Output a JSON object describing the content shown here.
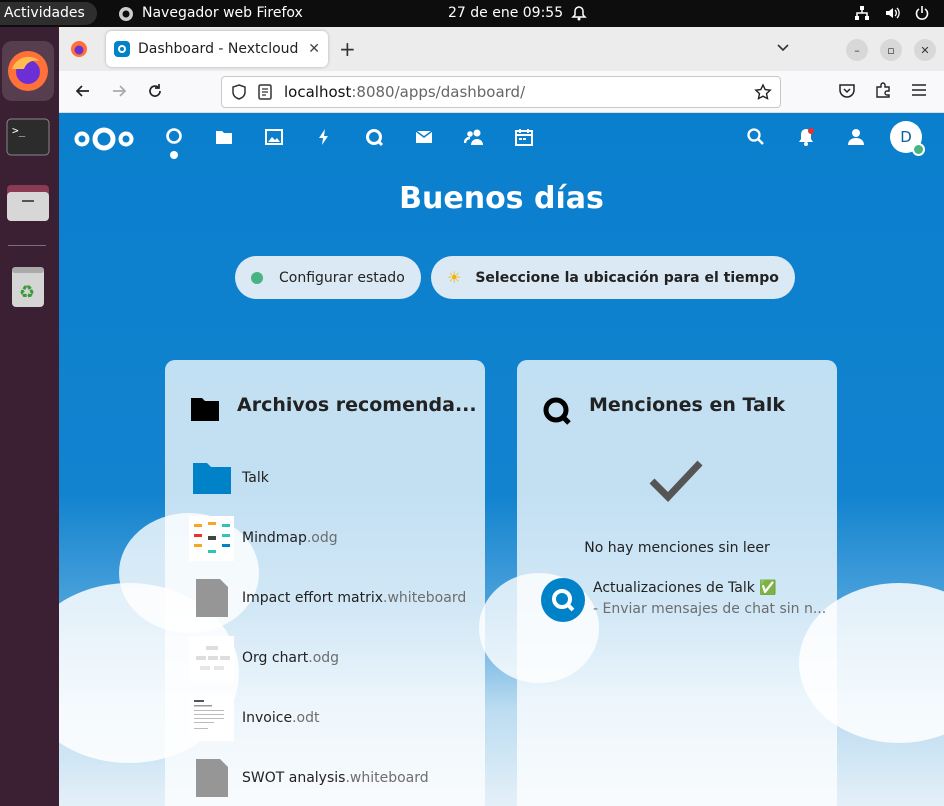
{
  "topbar": {
    "activities": "Actividades",
    "app_name": "Navegador web Firefox",
    "clock": "27 de ene  09:55"
  },
  "browser": {
    "tab_title": "Dashboard - Nextcloud",
    "url_host": "localhost",
    "url_path": ":8080/apps/dashboard/"
  },
  "nextcloud": {
    "greeting": "Buenos días",
    "status_button": "Configurar estado",
    "weather_button": "Seleccione la ubicación para el tiempo",
    "avatar_initial": "D",
    "files_panel": {
      "title": "Archivos recomenda...",
      "items": [
        {
          "name": "Talk",
          "ext": ""
        },
        {
          "name": "Mindmap",
          "ext": ".odg"
        },
        {
          "name": "Impact effort matrix",
          "ext": ".whiteboard"
        },
        {
          "name": "Org chart",
          "ext": ".odg"
        },
        {
          "name": "Invoice",
          "ext": ".odt"
        },
        {
          "name": "SWOT analysis",
          "ext": ".whiteboard"
        }
      ]
    },
    "talk_panel": {
      "title": "Menciones en Talk",
      "empty_text": "No hay menciones sin leer",
      "item_title": "Actualizaciones de Talk ✅",
      "item_sub": "- Enviar mensajes de chat sin n..."
    }
  },
  "colors": {
    "nextcloud_blue": "#0082c9",
    "online_green": "#49b382"
  }
}
